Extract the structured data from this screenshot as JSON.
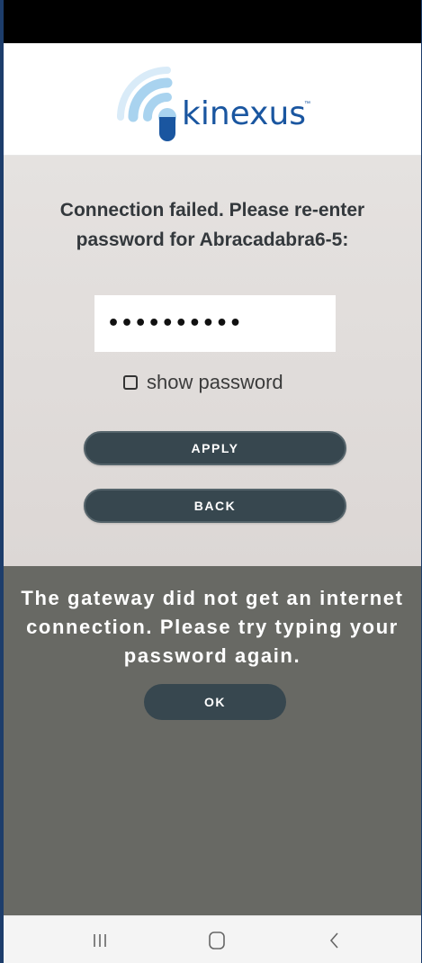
{
  "header": {
    "brand_name": "kinexus",
    "trademark": "™",
    "colors": {
      "logo_blue": "#1a56a0",
      "logo_light_blue": "#a9d3ef"
    }
  },
  "form": {
    "message": "Connection failed. Please re-enter password for Abracadabra6-5:",
    "password_masked": "••••••••••",
    "show_password": {
      "label": "show password",
      "checked": false
    },
    "apply_label": "APPLY",
    "back_label": "BACK"
  },
  "dialog": {
    "message": "The gateway did not get an internet connection. Please try typing your password again.",
    "ok_label": "OK"
  },
  "navbar": {
    "icons": [
      "recents-icon",
      "home-icon",
      "back-icon"
    ]
  },
  "colors": {
    "button_bg": "#37474f",
    "dialog_bg": "#686964",
    "content_bg": "#e2dedc"
  }
}
